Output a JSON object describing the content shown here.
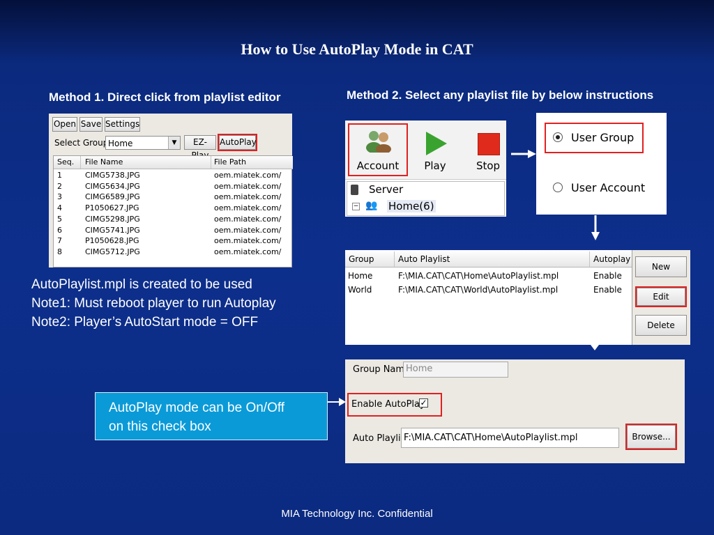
{
  "slide": {
    "title": "How to Use AutoPlay Mode in CAT",
    "method1_heading": "Method 1. Direct click from playlist editor",
    "method2_heading": "Method 2. Select any playlist file by below instructions",
    "notes": [
      "AutoPlaylist.mpl is created to be used",
      "Note1: Must reboot player to run Autoplay",
      "Note2: Player’s AutoStart mode = OFF"
    ],
    "callout_lines": [
      "AutoPlay mode can be On/Off",
      "on this check box"
    ],
    "footer": "MIA Technology Inc. Confidential"
  },
  "editor": {
    "buttons": {
      "open": "Open",
      "save": "Save",
      "settings": "Settings",
      "ezplay": "EZ-Play",
      "autoplay": "AutoPlay"
    },
    "select_group_label": "Select Group",
    "select_group_value": "Home",
    "columns": [
      "Seq.",
      "File Name",
      "File Path"
    ],
    "rows": [
      [
        "1",
        "CIMG5738.JPG",
        "oem.miatek.com/"
      ],
      [
        "2",
        "CIMG5634.JPG",
        "oem.miatek.com/"
      ],
      [
        "3",
        "CIMG6589.JPG",
        "oem.miatek.com/"
      ],
      [
        "4",
        "P1050627.JPG",
        "oem.miatek.com/"
      ],
      [
        "5",
        "CIMG5298.JPG",
        "oem.miatek.com/"
      ],
      [
        "6",
        "CIMG5741.JPG",
        "oem.miatek.com/"
      ],
      [
        "7",
        "P1050628.JPG",
        "oem.miatek.com/"
      ],
      [
        "8",
        "CIMG5712.JPG",
        "oem.miatek.com/"
      ]
    ]
  },
  "toolbar": {
    "account": "Account",
    "play": "Play",
    "stop": "Stop",
    "play_color": "#3aa32f",
    "stop_color": "#e02a1b"
  },
  "tree": {
    "server": "Server",
    "home": "Home(6)"
  },
  "radio": {
    "user_group": "User Group",
    "user_account": "User Account",
    "selected": "User Group"
  },
  "group_list": {
    "columns": [
      "Group",
      "Auto Playlist",
      "Autoplay"
    ],
    "rows": [
      [
        "Home",
        "F:\\MIA.CAT\\CAT\\Home\\AutoPlaylist.mpl",
        "Enable"
      ],
      [
        "World",
        "F:\\MIA.CAT\\CAT\\World\\AutoPlaylist.mpl",
        "Enable"
      ]
    ],
    "buttons": {
      "new": "New",
      "edit": "Edit",
      "delete": "Delete"
    }
  },
  "group_form": {
    "group_name_label": "Group Name",
    "group_name_value": "Home",
    "enable_autoplay_label": "Enable AutoPlay",
    "enable_autoplay_checked": true,
    "auto_playlist_label": "Auto Playlist",
    "auto_playlist_value": "F:\\MIA.CAT\\CAT\\Home\\AutoPlaylist.mpl",
    "browse": "Browse..."
  },
  "colors": {
    "highlight": "#e02020",
    "callout_bg": "#0a9ad8"
  }
}
